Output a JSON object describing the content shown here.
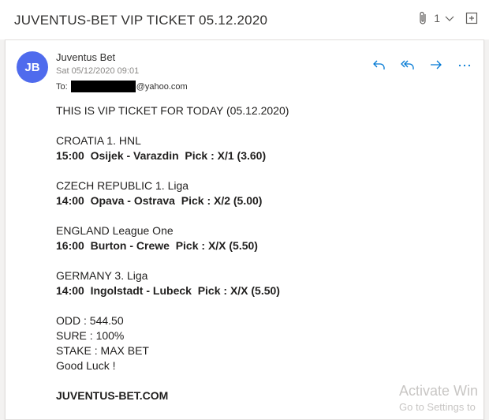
{
  "header": {
    "subject": "JUVENTUS-BET VIP TICKET 05.12.2020",
    "attachment_count": "1"
  },
  "message": {
    "avatar_initials": "JB",
    "sender": "Juventus Bet",
    "date": "Sat 05/12/2020 09:01",
    "to_label": "To:",
    "to_domain": "@yahoo.com"
  },
  "body": {
    "intro": "THIS IS VIP TICKET FOR TODAY (05.12.2020)",
    "matches": [
      {
        "league": "CROATIA 1. HNL",
        "pick": "15:00  Osijek - Varazdin  Pick : X/1 (3.60)"
      },
      {
        "league": "CZECH REPUBLIC 1. Liga",
        "pick": "14:00  Opava - Ostrava  Pick : X/2 (5.00)"
      },
      {
        "league": "ENGLAND League One",
        "pick": "16:00  Burton - Crewe  Pick : X/X (5.50)"
      },
      {
        "league": "GERMANY 3. Liga",
        "pick": "14:00  Ingolstadt - Lubeck  Pick : X/X (5.50)"
      }
    ],
    "odd": "ODD : 544.50",
    "sure": "SURE : 100%",
    "stake": "STAKE : MAX BET",
    "good_luck": "Good Luck !",
    "site": "JUVENTUS-BET.COM"
  },
  "watermark": {
    "line1": "Activate Win",
    "line2": "Go to Settings to"
  },
  "colors": {
    "avatar": "#4f6bed",
    "action_icons": "#0078d4"
  },
  "icons": [
    "paperclip-icon",
    "chevron-down-icon",
    "popout-icon",
    "reply-icon",
    "reply-all-icon",
    "forward-icon",
    "more-icon"
  ]
}
